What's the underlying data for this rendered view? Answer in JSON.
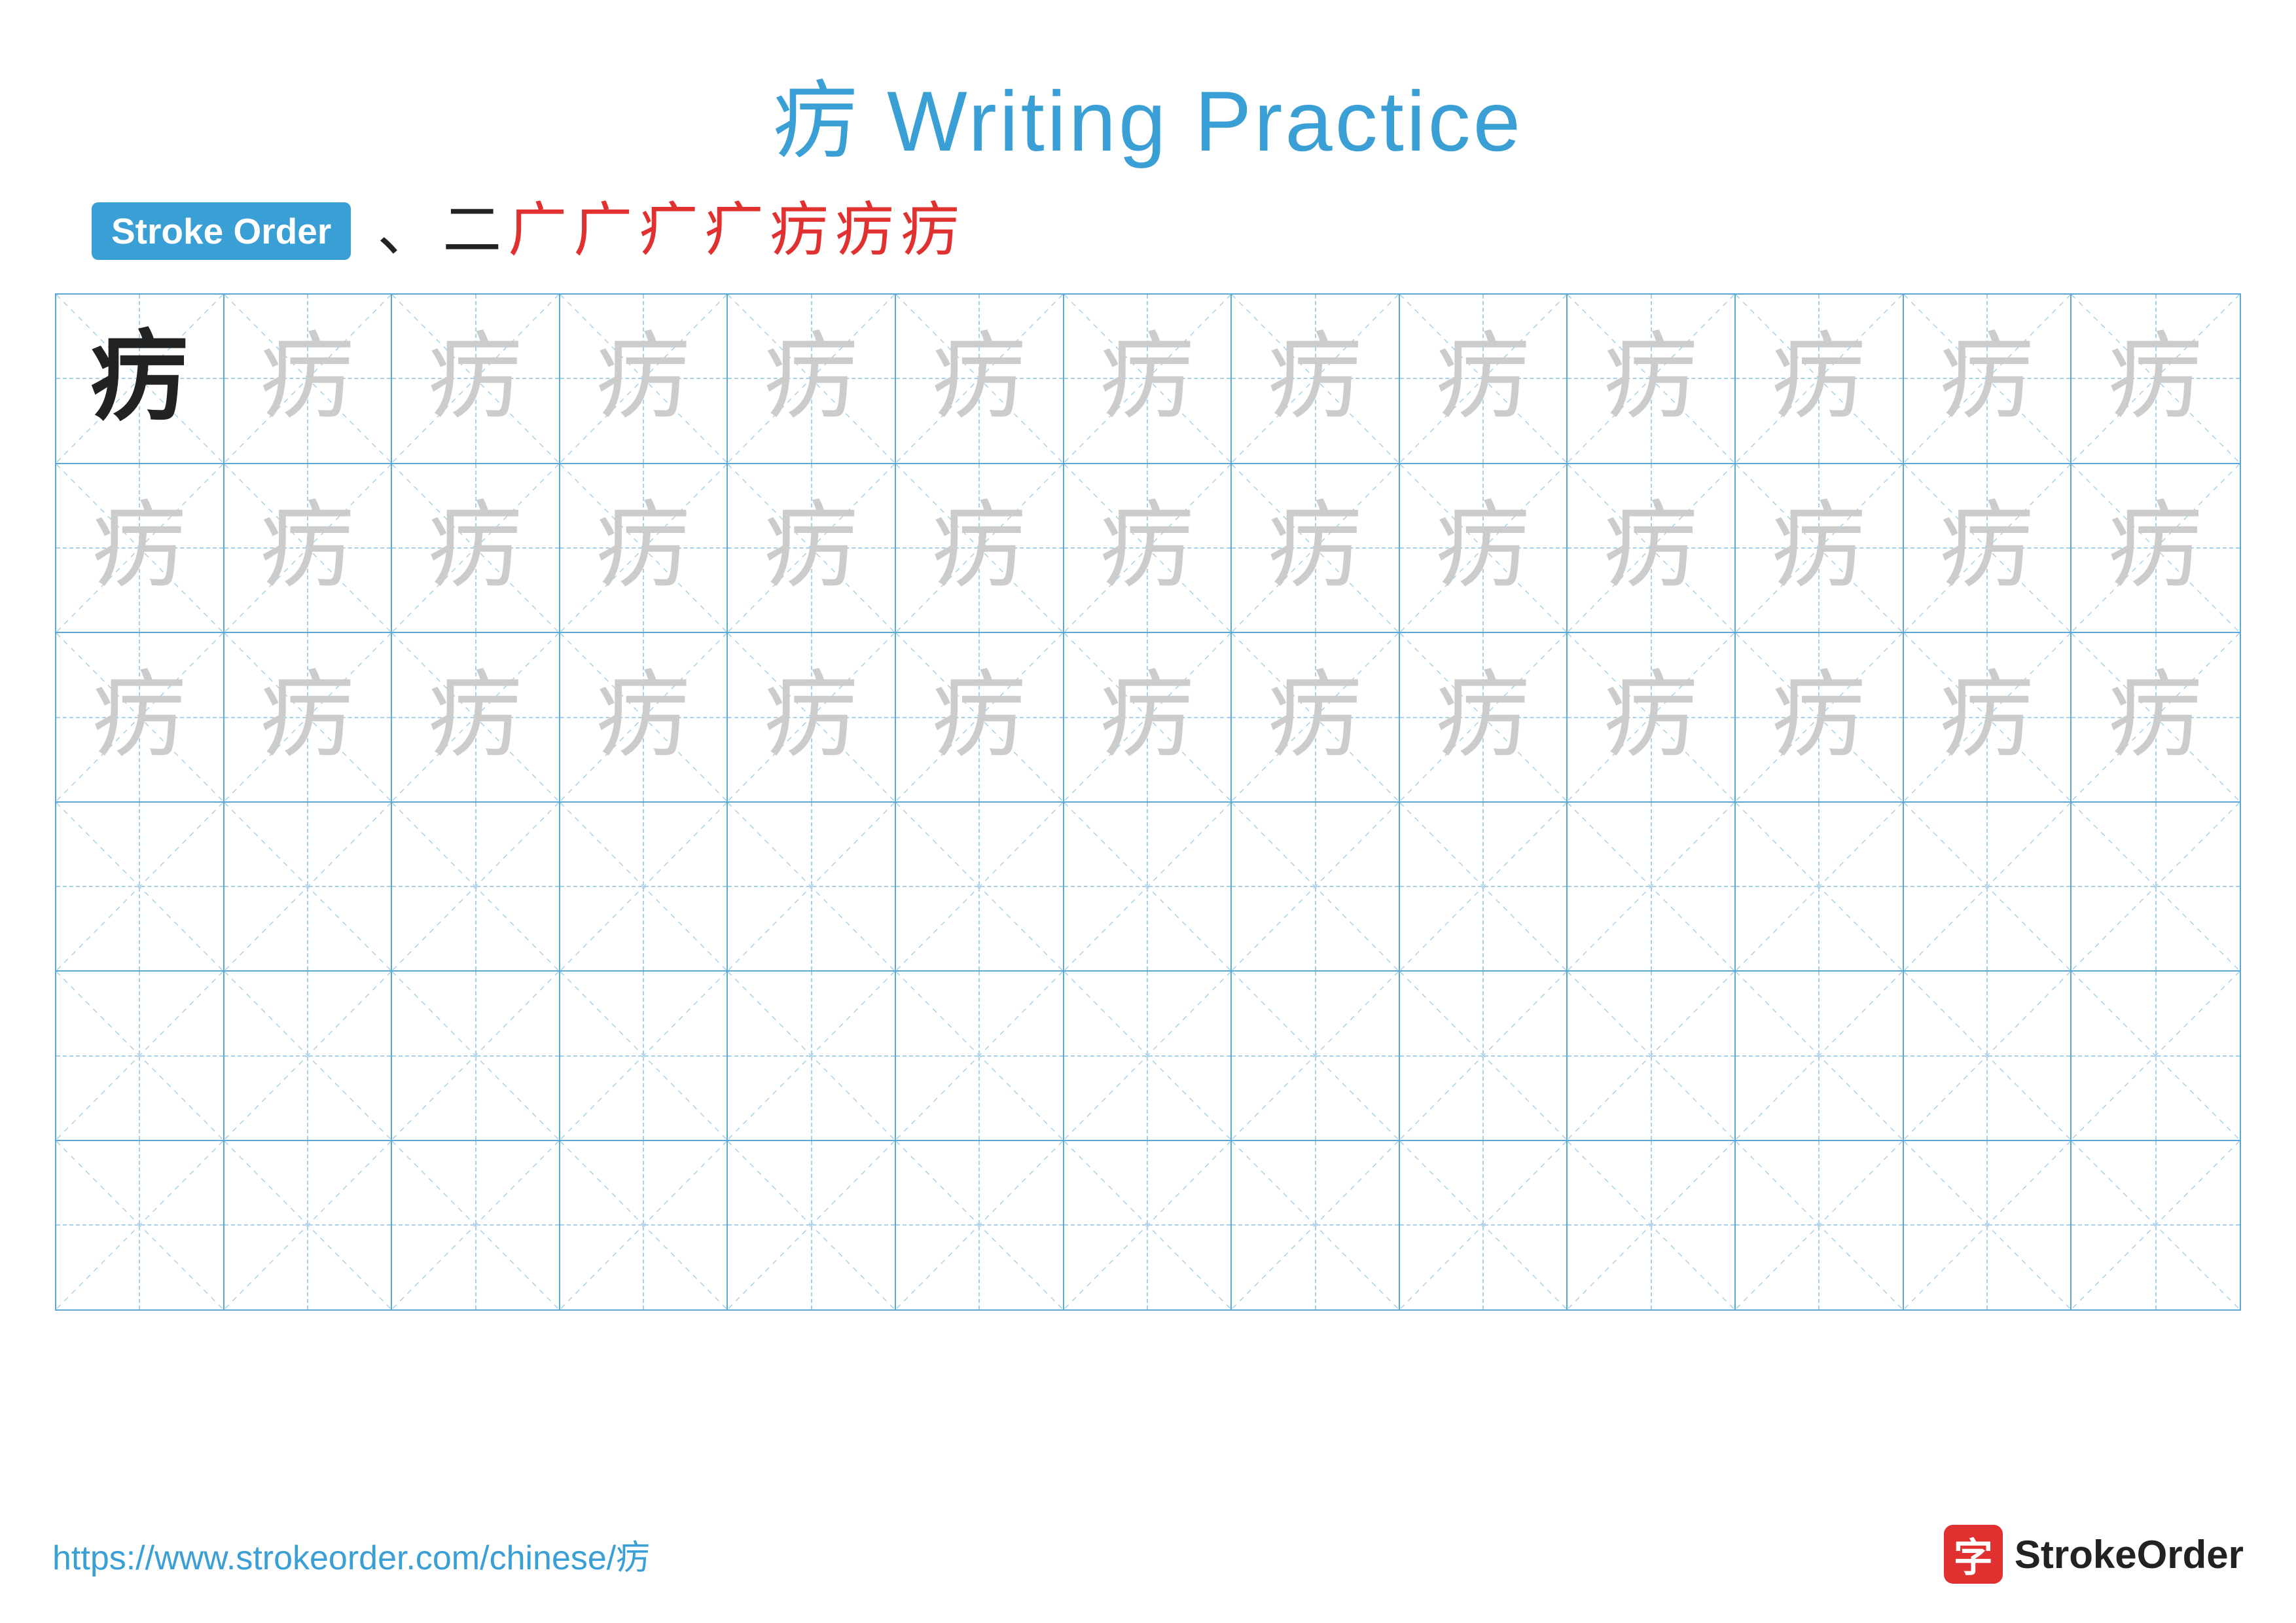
{
  "title": {
    "chinese_char": "疠",
    "label": "Writing Practice",
    "full": "疠 Writing Practice"
  },
  "stroke_order": {
    "badge_label": "Stroke Order",
    "strokes": [
      "、",
      "二",
      "广",
      "广",
      "疒",
      "疒",
      "疠",
      "疠",
      "疠"
    ]
  },
  "grid": {
    "rows": 6,
    "cols": 13,
    "char": "疠",
    "row_types": [
      "dark-first",
      "light",
      "light",
      "empty",
      "empty",
      "empty"
    ]
  },
  "footer": {
    "url": "https://www.strokeorder.com/chinese/疠",
    "logo_char": "字",
    "logo_name": "StrokeOrder"
  }
}
